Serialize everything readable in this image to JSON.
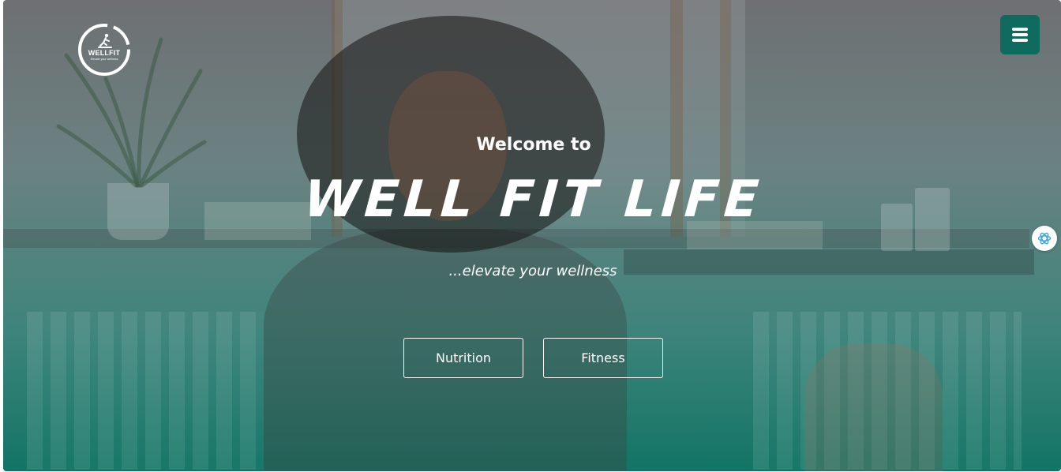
{
  "logo": {
    "title": "WELLFIT",
    "tagline": "Elevate your wellness",
    "icon": "runner-icon"
  },
  "header": {
    "menu_icon": "hamburger-menu-icon",
    "accent_color": "#0f6b5e"
  },
  "hero": {
    "welcome": "Welcome to",
    "title": "WELL FIT LIFE",
    "tagline": "...elevate your wellness",
    "buttons": [
      {
        "label": "Nutrition"
      },
      {
        "label": "Fitness"
      }
    ]
  },
  "widgets": {
    "chat_icon": "ai-assistant-icon"
  }
}
